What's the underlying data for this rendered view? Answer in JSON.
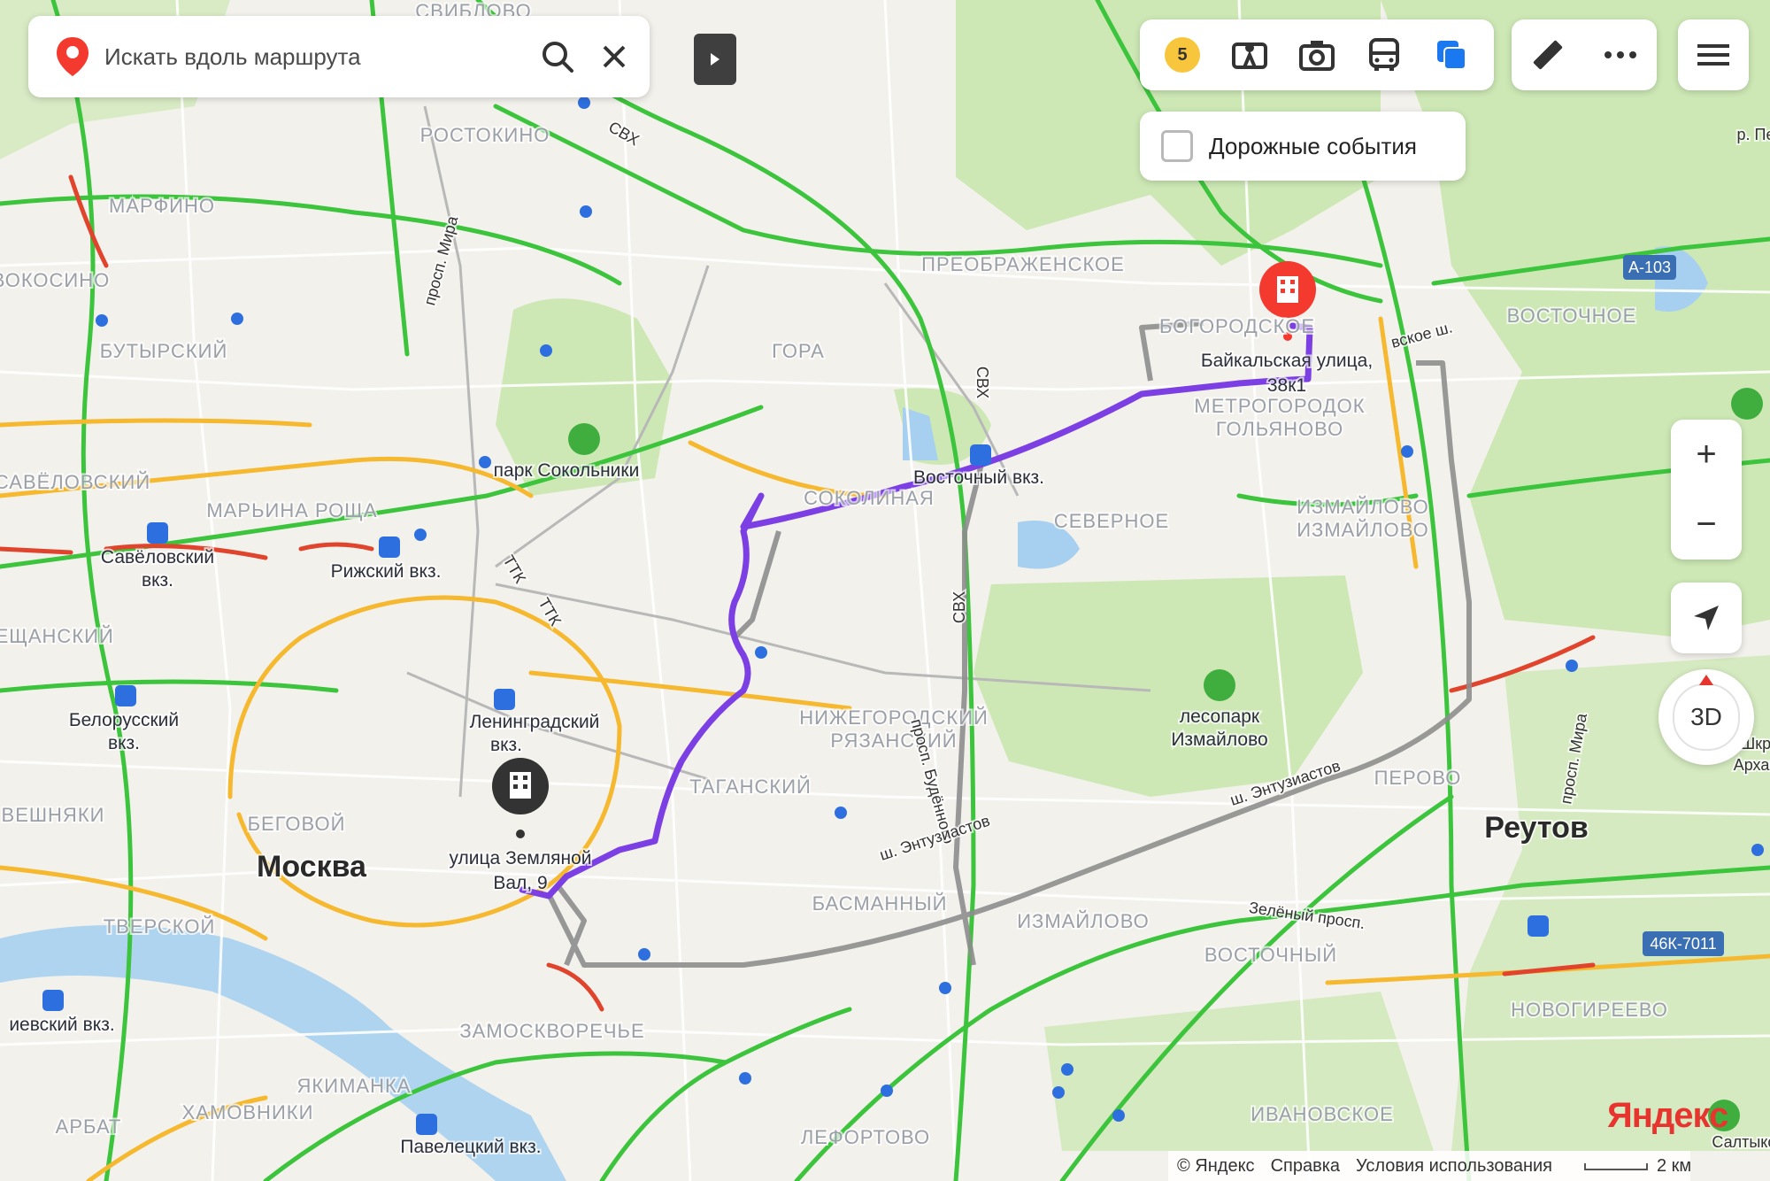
{
  "search": {
    "placeholder": "Искать вдоль маршрута"
  },
  "toolbar": {
    "traffic_score": "5",
    "icons": [
      "traffic-icon",
      "panorama-icon",
      "camera-icon",
      "transport-icon",
      "layers-icon",
      "ruler-icon",
      "more-icon",
      "menu-icon"
    ]
  },
  "traffic_events": {
    "label": "Дорожные события",
    "checked": false
  },
  "controls": {
    "zoom_in": "+",
    "zoom_out": "−",
    "compass_label": "3D"
  },
  "route": {
    "start_label_line1": "улица Земляной",
    "start_label_line2": "Вал, 9",
    "end_label_line1": "Байкальская улица,",
    "end_label_line2": "38к1"
  },
  "map_labels": {
    "districts": [
      "СВИБЛОВО",
      "РОСТОКИНО",
      "МАРФИНО",
      "БУТЫРСКИЙ",
      "САВЁЛОВСКИЙ",
      "МАРЬИНА РОЩА",
      "МЕЩАНСКИЙ",
      "БЕГОВОЙ",
      "ТВЕРСКОЙ",
      "АРБАТ",
      "ХАМОВНИКИ",
      "ЯКИМАНКА",
      "ЗАМОСКВОРЕЧЬЕ",
      "ТАГАНСКИЙ",
      "БАСМАННЫЙ",
      "ЛЕФОРТОВО",
      "НИЖЕГОРОДСКИЙ",
      "РЯЗАНСКИЙ",
      "СОКОЛИНАЯ",
      "ГОРА",
      "ПРЕОБРАЖЕНСКОЕ",
      "БОГОРОДСКОЕ",
      "МЕТРОГОРОДОК",
      "ГОЛЬЯНОВО",
      "СЕВЕРНОЕ",
      "ИЗМАЙЛОВО",
      "ИЗМАЙЛОВО",
      "ВОСТОЧНОЕ",
      "ИЗМАЙЛОВО",
      "ВОСТОЧНЫЙ",
      "ПЕРОВО",
      "НОВОГИРЕЕВО",
      "ИВАНОВСКОЕ",
      "НОВОКОСИНО",
      "ВЕШНЯКИ",
      "ЕВСКИЙ",
      "ЕНСКИЙ"
    ],
    "stations": [
      "Савёловский",
      "вкз.",
      "Рижский вкз.",
      "Белорусский",
      "вкз.",
      "Ленинградский",
      "вкз.",
      "Восточный вкз.",
      "Павелецкий вкз.",
      "иевский вкз."
    ],
    "parks": [
      "парк Сокольники",
      "лесопарк",
      "Измайлово"
    ],
    "cities": [
      "Москва",
      "Реутов"
    ],
    "roads": [
      "СВХ",
      "СВХ",
      "СВХ",
      "ТТК",
      "ТТК",
      "просп. Мира",
      "просп. Будённого",
      "ш. Энтузиастов",
      "ш. Энтузиастов",
      "Зелёный просп.",
      "A-103",
      "46К-7011",
      "вское ш.",
      "р. Пе",
      "просп. Мира",
      "Архан",
      "Салтыковск",
      "Шкр"
    ]
  },
  "footer": {
    "logo": "Яндекс",
    "copyright": "© Яндекс",
    "help": "Справка",
    "terms": "Условия использования",
    "scale": "2 км"
  },
  "colors": {
    "route_active": "#7b3fe4",
    "route_alt": "#8e8e8e",
    "traffic_green": "#3cc43c",
    "traffic_yellow": "#f5b82e",
    "traffic_red": "#e0442c",
    "park": "#cde8b5",
    "marker_end": "#f43a2f",
    "marker_start": "#333333"
  }
}
